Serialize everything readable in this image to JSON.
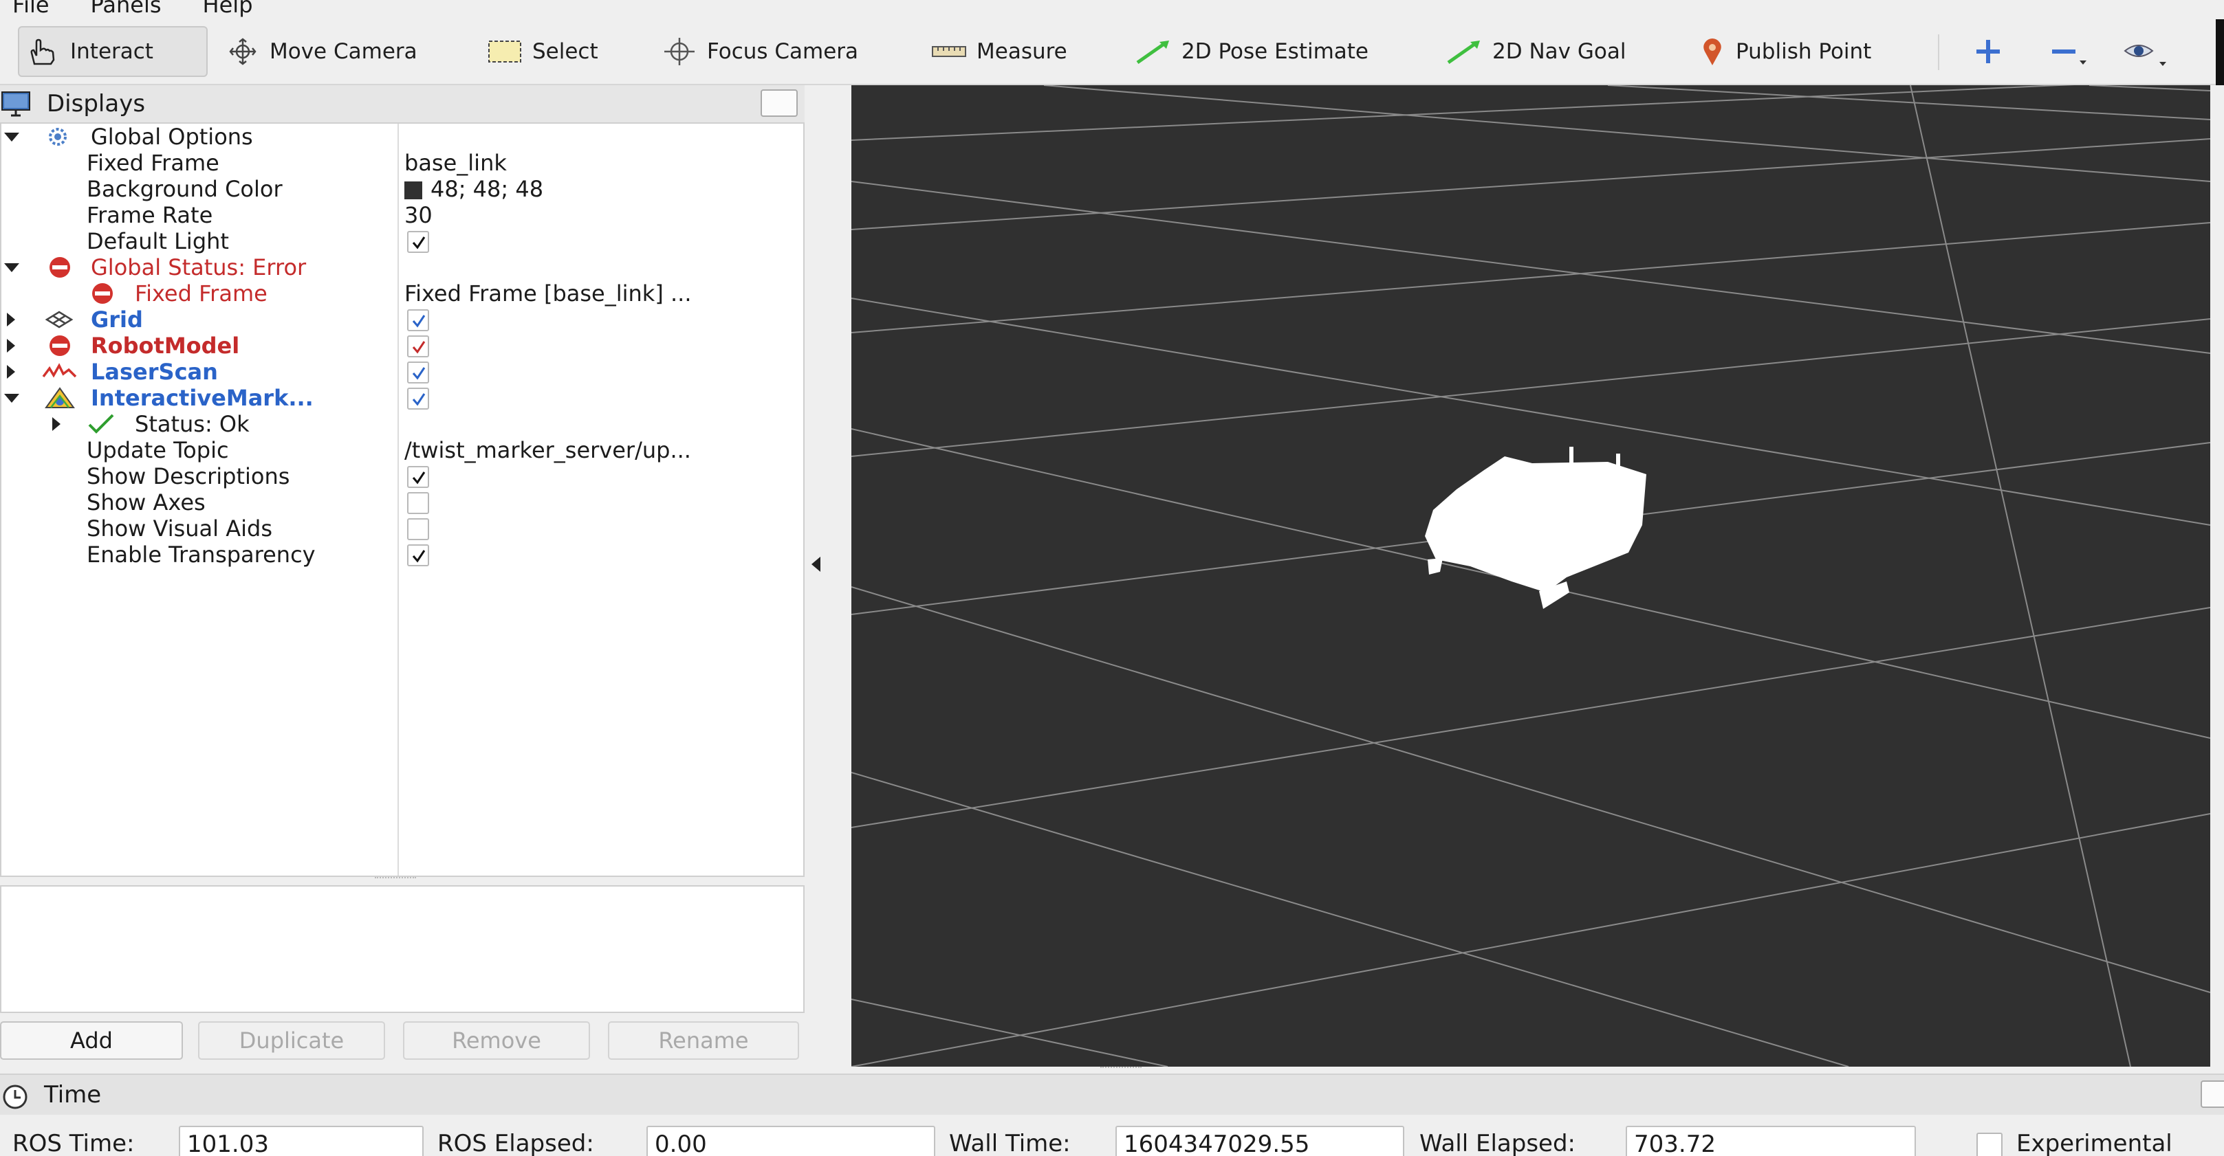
{
  "menubar": [
    "File",
    "Panels",
    "Help"
  ],
  "toolbar": {
    "interact": "Interact",
    "move_camera": "Move Camera",
    "select": "Select",
    "focus_camera": "Focus Camera",
    "measure": "Measure",
    "pose_estimate": "2D Pose Estimate",
    "nav_goal": "2D Nav Goal",
    "publish_point": "Publish Point"
  },
  "displays": {
    "title": "Displays",
    "global_options": "Global Options",
    "fixed_frame": {
      "label": "Fixed Frame",
      "value": "base_link"
    },
    "background_color": {
      "label": "Background Color",
      "value": "48; 48; 48"
    },
    "frame_rate": {
      "label": "Frame Rate",
      "value": "30"
    },
    "default_light": {
      "label": "Default Light",
      "checked": true
    },
    "global_status": "Global Status: Error",
    "fixed_frame_error": {
      "label": "Fixed Frame",
      "value": "Fixed Frame [base_link] ..."
    },
    "grid": {
      "label": "Grid",
      "checked": true
    },
    "robot_model": {
      "label": "RobotModel",
      "checked": true
    },
    "laser_scan": {
      "label": "LaserScan",
      "checked": true
    },
    "interactive_markers": {
      "label": "InteractiveMark...",
      "checked": true
    },
    "status_ok": "Status: Ok",
    "update_topic": {
      "label": "Update Topic",
      "value": "/twist_marker_server/up..."
    },
    "show_descriptions": {
      "label": "Show Descriptions",
      "checked": true
    },
    "show_axes": {
      "label": "Show Axes",
      "checked": false
    },
    "show_visual_aids": {
      "label": "Show Visual Aids",
      "checked": false
    },
    "enable_transparency": {
      "label": "Enable Transparency",
      "checked": true
    }
  },
  "buttons": {
    "add": "Add",
    "duplicate": "Duplicate",
    "remove": "Remove",
    "rename": "Rename"
  },
  "time": {
    "title": "Time",
    "ros_time_label": "ROS Time:",
    "ros_time": "101.03",
    "ros_elapsed_label": "ROS Elapsed:",
    "ros_elapsed": "0.00",
    "wall_time_label": "Wall Time:",
    "wall_time": "1604347029.55",
    "wall_elapsed_label": "Wall Elapsed:",
    "wall_elapsed": "703.72",
    "experimental_label": "Experimental",
    "experimental_checked": false
  },
  "colors": {
    "viewport_bg": "#303030",
    "error": "#c42b2b",
    "link_blue": "#2a63c8"
  }
}
